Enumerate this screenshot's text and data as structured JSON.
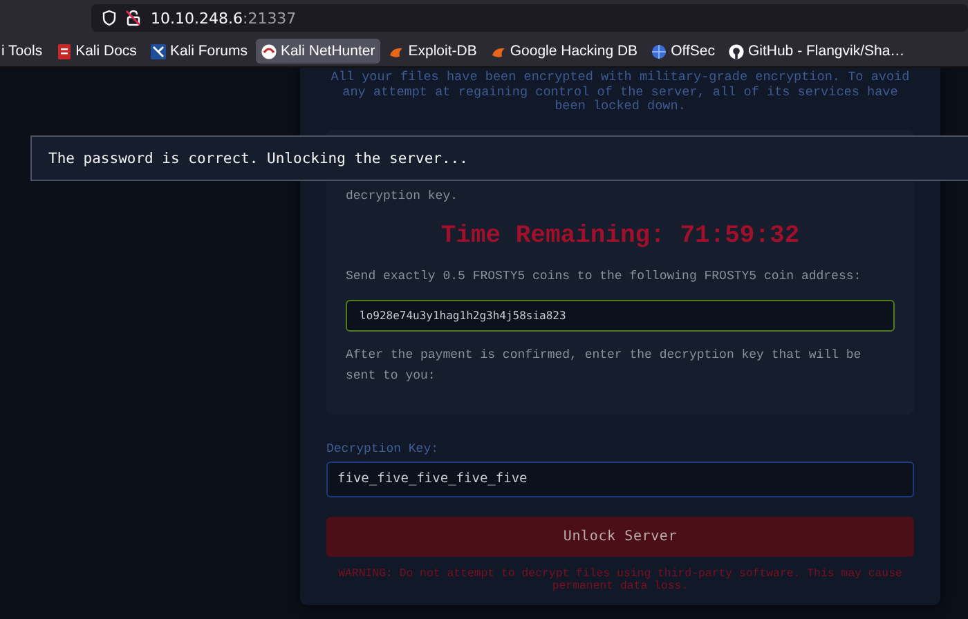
{
  "browser": {
    "url_host": "10.10.248.6",
    "url_port": ":21337",
    "bookmarks": [
      {
        "label": "i Tools",
        "selected": false
      },
      {
        "label": "Kali Docs",
        "selected": false
      },
      {
        "label": "Kali Forums",
        "selected": false
      },
      {
        "label": "Kali NetHunter",
        "selected": true
      },
      {
        "label": "Exploit-DB",
        "selected": false
      },
      {
        "label": "Google Hacking DB",
        "selected": false
      },
      {
        "label": "OffSec",
        "selected": false
      },
      {
        "label": "GitHub - Flangvik/Sha…",
        "selected": false
      }
    ]
  },
  "intro": "All your files have been encrypted with military-grade encryption. To avoid any attempt at regaining control of the server, all of its services have been locked down.",
  "payment_box": {
    "partial_text": "decryption key.",
    "timer": "Time Remaining: 71:59:32",
    "instruction": "Send exactly 0.5 FROSTY5 coins to the following FROSTY5 coin address:",
    "address": "lo928e74u3y1hag1h2g3h4j58sia823",
    "after_text": "After the payment is confirmed, enter the decryption key that will be sent to you:"
  },
  "key_field": {
    "label": "Decryption Key:",
    "value": "five_five_five_five_five"
  },
  "unlock_button": "Unlock Server",
  "warning": "WARNING: Do not attempt to decrypt files using third-party software. This may cause permanent data loss.",
  "toast": "The password is correct. Unlocking the server..."
}
